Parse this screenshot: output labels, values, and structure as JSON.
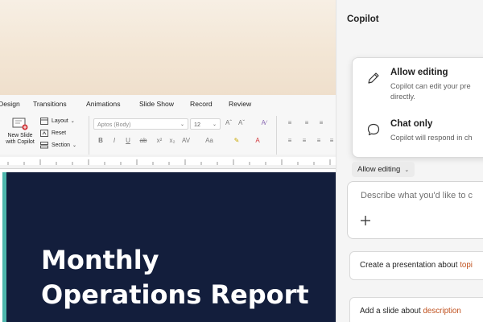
{
  "ribbon": {
    "tabs": [
      "Design",
      "Transitions",
      "Animations",
      "Slide Show",
      "Record",
      "Review"
    ],
    "new_slide_label_line1": "New Slide",
    "new_slide_label_line2": "with Copilot",
    "layout_label": "Layout",
    "reset_label": "Reset",
    "section_label": "Section",
    "font_name": "Aptos (Body)",
    "font_size": "12"
  },
  "slide": {
    "title_line1": "Monthly",
    "title_line2": "Operations Report"
  },
  "copilot": {
    "title": "Copilot",
    "modes": [
      {
        "label": "Allow editing",
        "desc_line1": "Copilot can edit your pre",
        "desc_line2": "directly."
      },
      {
        "label": "Chat only",
        "desc_line1": "Copilot will respond in ch",
        "desc_line2": ""
      }
    ],
    "current_mode": "Allow editing",
    "input_placeholder": "Describe what you'd like to c",
    "suggestions": [
      {
        "prefix": "Create a presentation about ",
        "highlight": "topi"
      },
      {
        "prefix": "Add a slide about ",
        "highlight": "description"
      }
    ]
  },
  "colors": {
    "slide_bg": "#131e3c",
    "slide_accent": "#4db6ac",
    "suggestion_highlight": "#c0521f"
  },
  "icons": [
    "new-slide-icon",
    "layout-icon",
    "reset-icon",
    "section-icon",
    "pencil-icon",
    "chat-bubble-icon",
    "plus-icon",
    "chevron-down-icon"
  ]
}
